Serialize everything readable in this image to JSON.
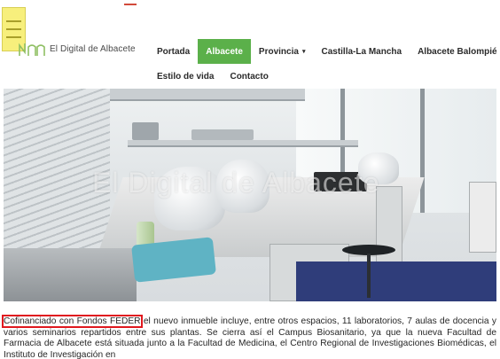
{
  "header": {
    "logo_text": "El Digital de Albacete",
    "nav_row1": [
      {
        "label": "Portada",
        "active": false,
        "has_caret": false
      },
      {
        "label": "Albacete",
        "active": true,
        "has_caret": false
      },
      {
        "label": "Provincia",
        "active": false,
        "has_caret": true
      },
      {
        "label": "Castilla-La Mancha",
        "active": false,
        "has_caret": false
      },
      {
        "label": "Albacete Balompié",
        "active": false,
        "has_caret": false
      }
    ],
    "nav_row2": [
      {
        "label": "Estilo de vida"
      },
      {
        "label": "Contacto"
      }
    ],
    "caret_glyph": "▾",
    "accent_color": "#5bb04a",
    "menu_button_color": "#f7ef7c"
  },
  "hero": {
    "watermark": "El Digital de Albacete",
    "icons": [
      "lab-scene-image"
    ]
  },
  "article": {
    "highlighted": "Cofinanciado con Fondos FEDER",
    "body": " el nuevo inmueble incluye, entre otros espacios, 11 laboratorios, 7 aulas de docencia y varios seminarios repartidos entre sus plantas. Se cierra así el Campus Biosanitario, ya que la nueva Facultad de Farmacia de Albacete está situada junto a la Facultad de Medicina, el Centro Regional de Investigaciones Biomédicas, el Instituto de Investigación en",
    "highlight_color": "#e0191f"
  }
}
